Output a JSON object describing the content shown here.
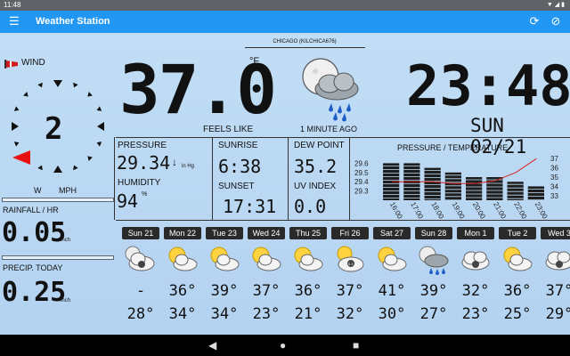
{
  "status": {
    "time": "11:48",
    "icons": "▼◢▮"
  },
  "app": {
    "title": "Weather Station"
  },
  "station": {
    "name": "CHICAGO (KILCHICA676)"
  },
  "temperature": {
    "value": "37.0",
    "unit": "°F",
    "feels_like_label": "FEELS LIKE"
  },
  "update": {
    "ago": "1 MINUTE AGO"
  },
  "clock": {
    "time": "23:48",
    "date": "SUN 02/21"
  },
  "wind": {
    "label": "WIND",
    "speed": "2",
    "dir_label": "W",
    "unit": "MPH"
  },
  "rainfall": {
    "label": "RAINFALL / HR",
    "value": "0.05",
    "unit": "inch"
  },
  "precip": {
    "label": "PRECIP. TODAY",
    "value": "0.25",
    "unit": "inch"
  },
  "pressure": {
    "label": "PRESSURE",
    "value": "29.34",
    "trend": "↓",
    "unit": "in Hg"
  },
  "humidity": {
    "label": "HUMIDITY",
    "value": "94",
    "unit": "%"
  },
  "sunrise": {
    "label": "SUNRISE",
    "value": "6:38"
  },
  "sunset": {
    "label": "SUNSET",
    "value": "17:31"
  },
  "dewpoint": {
    "label": "DEW POINT",
    "value": "35.2"
  },
  "uv": {
    "label": "UV INDEX",
    "value": "0.0"
  },
  "chart_data": {
    "type": "bar",
    "title": "PRESSURE / TEMPERATURE",
    "categories": [
      "16:00",
      "17:00",
      "18:00",
      "19:00",
      "20:00",
      "21:00",
      "22:00",
      "23:00"
    ],
    "series": [
      {
        "values": [
          29.6,
          29.6,
          29.55,
          29.5,
          29.45,
          29.45,
          29.4,
          29.35
        ]
      },
      {
        "values": [
          34.5,
          34.5,
          34.5,
          34.3,
          34.3,
          34.6,
          35.5,
          37.0
        ]
      }
    ],
    "left_ticks": [
      "29.6",
      "29.5",
      "29.4",
      "29.3"
    ],
    "right_ticks": [
      "37",
      "36",
      "35",
      "34",
      "33"
    ],
    "ylim_left": [
      29.2,
      29.7
    ],
    "ylim_right": [
      32.5,
      37.5
    ]
  },
  "forecast": [
    {
      "day": "Sun 21",
      "hi": "-",
      "lo": "28°",
      "icon": "partly-cloudy-night-icon"
    },
    {
      "day": "Mon 22",
      "hi": "36°",
      "lo": "34°",
      "icon": "partly-cloudy-icon"
    },
    {
      "day": "Tue 23",
      "hi": "39°",
      "lo": "34°",
      "icon": "partly-cloudy-icon"
    },
    {
      "day": "Wed 24",
      "hi": "37°",
      "lo": "23°",
      "icon": "partly-cloudy-icon"
    },
    {
      "day": "Thu 25",
      "hi": "36°",
      "lo": "21°",
      "icon": "partly-cloudy-icon"
    },
    {
      "day": "Fri 26",
      "hi": "37°",
      "lo": "32°",
      "icon": "cloudy-sun-icon"
    },
    {
      "day": "Sat 27",
      "hi": "41°",
      "lo": "30°",
      "icon": "partly-cloudy-icon"
    },
    {
      "day": "Sun 28",
      "hi": "39°",
      "lo": "27°",
      "icon": "rain-night-icon"
    },
    {
      "day": "Mon 1",
      "hi": "32°",
      "lo": "23°",
      "icon": "cloudy-icon"
    },
    {
      "day": "Tue 2",
      "hi": "36°",
      "lo": "25°",
      "icon": "partly-cloudy-icon"
    },
    {
      "day": "Wed 3",
      "hi": "37°",
      "lo": "29°",
      "icon": "cloudy-icon"
    }
  ],
  "colors": {
    "appbar": "#2196f3",
    "background": "#c2def6",
    "wind_arrow": "#e81010"
  }
}
